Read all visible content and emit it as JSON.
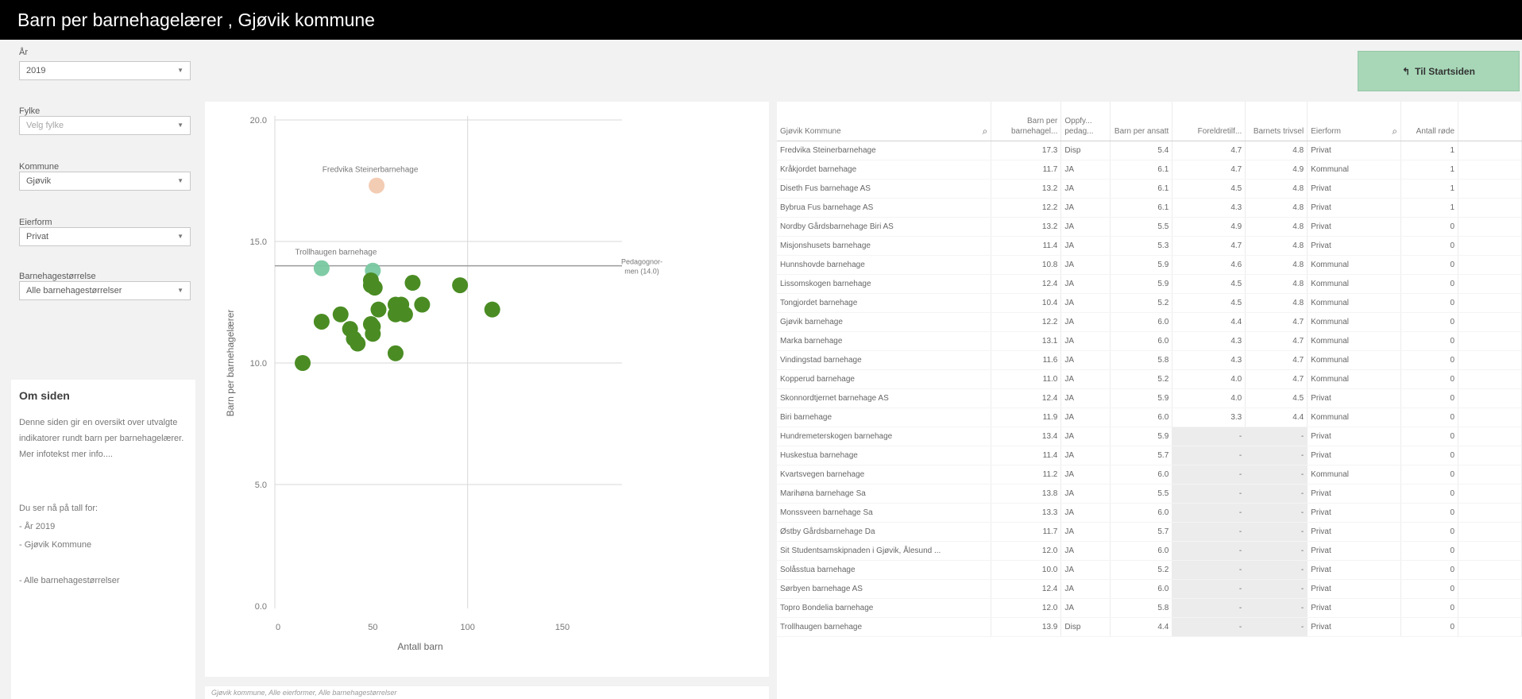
{
  "title": "Barn per barnehagelærer , Gjøvik kommune",
  "filters": {
    "year": {
      "label": "År",
      "value": "2019"
    },
    "county": {
      "label": "Fylke",
      "placeholder": "Velg fylke"
    },
    "municipality": {
      "label": "Kommune",
      "value": "Gjøvik"
    },
    "ownership": {
      "label": "Eierform",
      "value": "Privat"
    },
    "size": {
      "label": "Barnehagestørrelse",
      "value": "Alle barnehagestørrelser"
    }
  },
  "about": {
    "heading": "Om siden",
    "text": "Denne siden gir en oversikt over utvalgte indikatorer rundt barn per barnehagelærer. Mer infotekst mer info....",
    "showing_intro": "Du ser nå på tall for:",
    "line1": "- År 2019",
    "line2": "- Gjøvik Kommune",
    "line3": "- Alle barnehagestørrelser"
  },
  "start_button": {
    "label": "Til Startsiden",
    "icon": "return-arrow-icon"
  },
  "chart_footer": "Gjøvik kommune, Alle eierformer, Alle barnehagestørrelser",
  "chart_data": {
    "type": "scatter",
    "xlabel": "Antall barn",
    "ylabel": "Barn per barnehagelærer",
    "xlim": [
      0,
      150
    ],
    "ylim": [
      0,
      20
    ],
    "xticks": [
      "0",
      "50",
      "100",
      "150"
    ],
    "yticks": [
      "0.0",
      "5.0",
      "10.0",
      "15.0",
      "20.0"
    ],
    "reference_line": {
      "y": 14.0,
      "label": "Pedagognormen (14.0)"
    },
    "colors": {
      "main": "#4a8c23",
      "highlight_green": "#78c8a0",
      "highlight_pink": "#f2c9b0",
      "gridline": "#d9d9d9",
      "refline": "#9a9a9a"
    },
    "annotations": [
      {
        "text": "Fredvika Steinerbarnehage",
        "x": 52,
        "y": 17.3
      },
      {
        "text": "Trollhaugen barnehage",
        "x": 23,
        "y": 13.9
      }
    ],
    "points": [
      {
        "x": 52,
        "y": 17.3,
        "c": "pink"
      },
      {
        "x": 23,
        "y": 13.9,
        "c": "teal"
      },
      {
        "x": 50,
        "y": 13.8,
        "c": "teal"
      },
      {
        "x": 49,
        "y": 13.4,
        "c": "main"
      },
      {
        "x": 49,
        "y": 13.2,
        "c": "main"
      },
      {
        "x": 51,
        "y": 13.1,
        "c": "main"
      },
      {
        "x": 71,
        "y": 13.3,
        "c": "main"
      },
      {
        "x": 96,
        "y": 13.2,
        "c": "main"
      },
      {
        "x": 62,
        "y": 12.4,
        "c": "main"
      },
      {
        "x": 65,
        "y": 12.4,
        "c": "main"
      },
      {
        "x": 76,
        "y": 12.4,
        "c": "main"
      },
      {
        "x": 53,
        "y": 12.2,
        "c": "main"
      },
      {
        "x": 113,
        "y": 12.2,
        "c": "main"
      },
      {
        "x": 62,
        "y": 12.0,
        "c": "main"
      },
      {
        "x": 67,
        "y": 12.0,
        "c": "main"
      },
      {
        "x": 33,
        "y": 12.0,
        "c": "main"
      },
      {
        "x": 23,
        "y": 11.7,
        "c": "main"
      },
      {
        "x": 49,
        "y": 11.6,
        "c": "main"
      },
      {
        "x": 50,
        "y": 11.5,
        "c": "main"
      },
      {
        "x": 38,
        "y": 11.4,
        "c": "main"
      },
      {
        "x": 50,
        "y": 11.2,
        "c": "main"
      },
      {
        "x": 40,
        "y": 11.0,
        "c": "main"
      },
      {
        "x": 42,
        "y": 10.8,
        "c": "main"
      },
      {
        "x": 62,
        "y": 10.4,
        "c": "main"
      },
      {
        "x": 13,
        "y": 10.0,
        "c": "main"
      }
    ]
  },
  "table": {
    "columns": [
      {
        "label": "Gjøvik Kommune",
        "search": true
      },
      {
        "label": "Barn per barnehagel..."
      },
      {
        "label": "Oppfy... pedag..."
      },
      {
        "label": "Barn per ansatt"
      },
      {
        "label": "Foreldretilf..."
      },
      {
        "label": "Barnets trivsel"
      },
      {
        "label": "Eierform",
        "search": true
      },
      {
        "label": "Antall røde"
      }
    ],
    "rows": [
      {
        "name": "Fredvika Steinerbarnehage",
        "bpl": "17.3",
        "bpl_red": true,
        "opp": "Disp",
        "bpa": "5.4",
        "bpa_red": false,
        "for": "4.7",
        "for_red": false,
        "triv": "4.8",
        "eier": "Privat",
        "rode": "1",
        "rode_red": true
      },
      {
        "name": "Kråkjordet barnehage",
        "bpl": "11.7",
        "opp": "JA",
        "bpa": "6.1",
        "bpa_red": true,
        "for": "4.7",
        "triv": "4.9",
        "eier": "Kommunal",
        "rode": "1",
        "rode_red": true
      },
      {
        "name": "Diseth Fus barnehage AS",
        "bpl": "13.2",
        "opp": "JA",
        "bpa": "6.1",
        "bpa_red": true,
        "for": "4.5",
        "triv": "4.8",
        "eier": "Privat",
        "rode": "1",
        "rode_red": true
      },
      {
        "name": "Bybrua Fus barnehage AS",
        "bpl": "12.2",
        "opp": "JA",
        "bpa": "6.1",
        "bpa_red": true,
        "for": "4.3",
        "triv": "4.8",
        "eier": "Privat",
        "rode": "1",
        "rode_red": true
      },
      {
        "name": "Nordby Gårdsbarnehage Biri AS",
        "bpl": "13.2",
        "opp": "JA",
        "bpa": "5.5",
        "for": "4.9",
        "triv": "4.8",
        "eier": "Privat",
        "rode": "0"
      },
      {
        "name": "Misjonshusets barnehage",
        "bpl": "11.4",
        "opp": "JA",
        "bpa": "5.3",
        "for": "4.7",
        "triv": "4.8",
        "eier": "Privat",
        "rode": "0"
      },
      {
        "name": "Hunnshovde barnehage",
        "bpl": "10.8",
        "opp": "JA",
        "bpa": "5.9",
        "for": "4.6",
        "triv": "4.8",
        "eier": "Kommunal",
        "rode": "0"
      },
      {
        "name": "Lissomskogen barnehage",
        "bpl": "12.4",
        "opp": "JA",
        "bpa": "5.9",
        "for": "4.5",
        "triv": "4.8",
        "eier": "Kommunal",
        "rode": "0"
      },
      {
        "name": "Tongjordet barnehage",
        "bpl": "10.4",
        "opp": "JA",
        "bpa": "5.2",
        "for": "4.5",
        "triv": "4.8",
        "eier": "Kommunal",
        "rode": "0"
      },
      {
        "name": "Gjøvik barnehage",
        "bpl": "12.2",
        "opp": "JA",
        "bpa": "6.0",
        "for": "4.4",
        "triv": "4.7",
        "eier": "Kommunal",
        "rode": "0"
      },
      {
        "name": "Marka barnehage",
        "bpl": "13.1",
        "opp": "JA",
        "bpa": "6.0",
        "for": "4.3",
        "triv": "4.7",
        "eier": "Kommunal",
        "rode": "0"
      },
      {
        "name": "Vindingstad barnehage",
        "bpl": "11.6",
        "opp": "JA",
        "bpa": "5.8",
        "for": "4.3",
        "triv": "4.7",
        "eier": "Kommunal",
        "rode": "0"
      },
      {
        "name": "Kopperud barnehage",
        "bpl": "11.0",
        "opp": "JA",
        "bpa": "5.2",
        "for": "4.0",
        "triv": "4.7",
        "eier": "Kommunal",
        "rode": "0"
      },
      {
        "name": "Skonnordtjernet barnehage AS",
        "bpl": "12.4",
        "opp": "JA",
        "bpa": "5.9",
        "for": "4.0",
        "triv": "4.5",
        "eier": "Privat",
        "rode": "0"
      },
      {
        "name": "Biri barnehage",
        "bpl": "11.9",
        "opp": "JA",
        "bpa": "6.0",
        "for": "3.3",
        "for_red": true,
        "triv": "4.4",
        "eier": "Kommunal",
        "rode": "0"
      },
      {
        "name": "Hundremeterskogen barnehage",
        "bpl": "13.4",
        "opp": "JA",
        "bpa": "5.9",
        "for": "-",
        "triv": "-",
        "eier": "Privat",
        "rode": "0",
        "missing": true
      },
      {
        "name": "Huskestua barnehage",
        "bpl": "11.4",
        "opp": "JA",
        "bpa": "5.7",
        "for": "-",
        "triv": "-",
        "eier": "Privat",
        "rode": "0",
        "missing": true
      },
      {
        "name": "Kvartsvegen barnehage",
        "bpl": "11.2",
        "opp": "JA",
        "bpa": "6.0",
        "for": "-",
        "triv": "-",
        "eier": "Kommunal",
        "rode": "0",
        "missing": true
      },
      {
        "name": "Marihøna barnehage Sa",
        "bpl": "13.8",
        "opp": "JA",
        "bpa": "5.5",
        "for": "-",
        "triv": "-",
        "eier": "Privat",
        "rode": "0",
        "missing": true
      },
      {
        "name": "Monssveen barnehage Sa",
        "bpl": "13.3",
        "opp": "JA",
        "bpa": "6.0",
        "for": "-",
        "triv": "-",
        "eier": "Privat",
        "rode": "0",
        "missing": true
      },
      {
        "name": "Østby Gårdsbarnehage Da",
        "bpl": "11.7",
        "opp": "JA",
        "bpa": "5.7",
        "for": "-",
        "triv": "-",
        "eier": "Privat",
        "rode": "0",
        "missing": true
      },
      {
        "name": "Sit Studentsamskipnaden i Gjøvik, Ålesund ...",
        "bpl": "12.0",
        "opp": "JA",
        "bpa": "6.0",
        "for": "-",
        "triv": "-",
        "eier": "Privat",
        "rode": "0",
        "missing": true
      },
      {
        "name": "Solåsstua barnehage",
        "bpl": "10.0",
        "opp": "JA",
        "bpa": "5.2",
        "for": "-",
        "triv": "-",
        "eier": "Privat",
        "rode": "0",
        "missing": true
      },
      {
        "name": "Sørbyen barnehage AS",
        "bpl": "12.4",
        "opp": "JA",
        "bpa": "6.0",
        "for": "-",
        "triv": "-",
        "eier": "Privat",
        "rode": "0",
        "missing": true
      },
      {
        "name": "Topro Bondelia barnehage",
        "bpl": "12.0",
        "opp": "JA",
        "bpa": "5.8",
        "for": "-",
        "triv": "-",
        "eier": "Privat",
        "rode": "0",
        "missing": true
      },
      {
        "name": "Trollhaugen barnehage",
        "bpl": "13.9",
        "opp": "Disp",
        "bpa": "4.4",
        "for": "-",
        "triv": "-",
        "eier": "Privat",
        "rode": "0",
        "missing": true
      }
    ]
  }
}
